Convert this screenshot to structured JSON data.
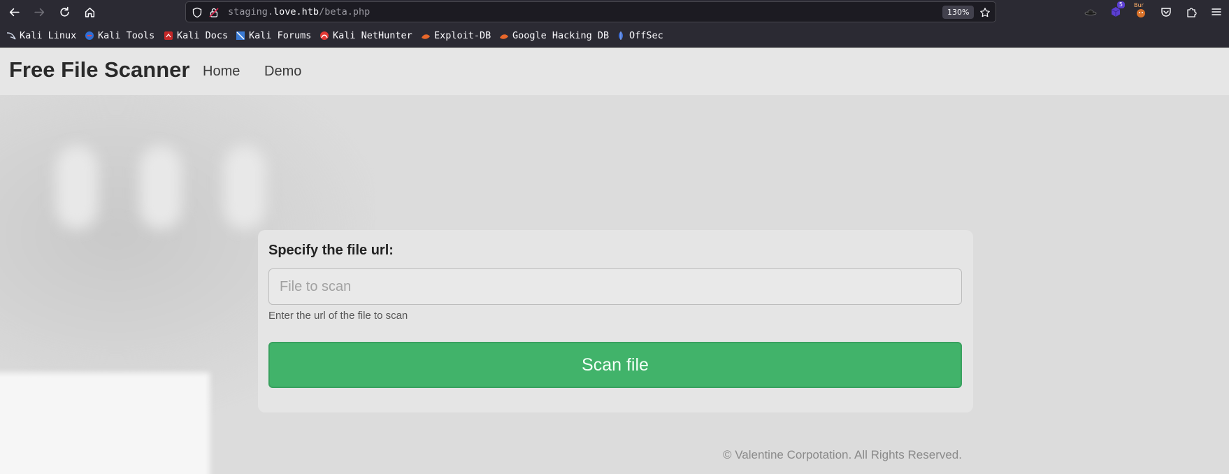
{
  "browser": {
    "url_prefix": "staging.",
    "url_host": "love.htb",
    "url_path": "/beta.php",
    "zoom": "130%",
    "extensions": {
      "notifications_count": "5",
      "burp_label": "Bur"
    },
    "bookmarks": [
      {
        "label": "Kali Linux",
        "icon": "kali-dragon-icon"
      },
      {
        "label": "Kali Tools",
        "icon": "kali-tools-icon"
      },
      {
        "label": "Kali Docs",
        "icon": "kali-docs-icon"
      },
      {
        "label": "Kali Forums",
        "icon": "kali-forums-icon"
      },
      {
        "label": "Kali NetHunter",
        "icon": "nethunter-icon"
      },
      {
        "label": "Exploit-DB",
        "icon": "exploitdb-icon"
      },
      {
        "label": "Google Hacking DB",
        "icon": "ghdb-icon"
      },
      {
        "label": "OffSec",
        "icon": "offsec-icon"
      }
    ]
  },
  "navbar": {
    "brand": "Free File Scanner",
    "links": [
      "Home",
      "Demo"
    ]
  },
  "form": {
    "label": "Specify the file url:",
    "input_value": "",
    "input_placeholder": "File to scan",
    "help_text": "Enter the url of the file to scan",
    "submit_label": "Scan file"
  },
  "footer": {
    "text": "© Valentine Corpotation. All Rights Reserved."
  },
  "colors": {
    "chrome_bg": "#2b2a33",
    "urlbar_bg": "#1c1b22",
    "page_bg": "#dcdcdc",
    "button_green": "#41b36a"
  }
}
